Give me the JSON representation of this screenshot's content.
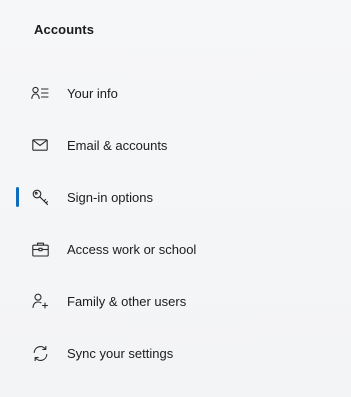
{
  "sidebar": {
    "title": "Accounts",
    "accent_color": "#0f6cbd",
    "items": [
      {
        "label": "Your info",
        "icon": "person-info-icon",
        "active": false
      },
      {
        "label": "Email & accounts",
        "icon": "mail-icon",
        "active": false
      },
      {
        "label": "Sign-in options",
        "icon": "key-icon",
        "active": true
      },
      {
        "label": "Access work or school",
        "icon": "briefcase-icon",
        "active": false
      },
      {
        "label": "Family & other users",
        "icon": "person-add-icon",
        "active": false
      },
      {
        "label": "Sync your settings",
        "icon": "sync-icon",
        "active": false
      }
    ]
  }
}
